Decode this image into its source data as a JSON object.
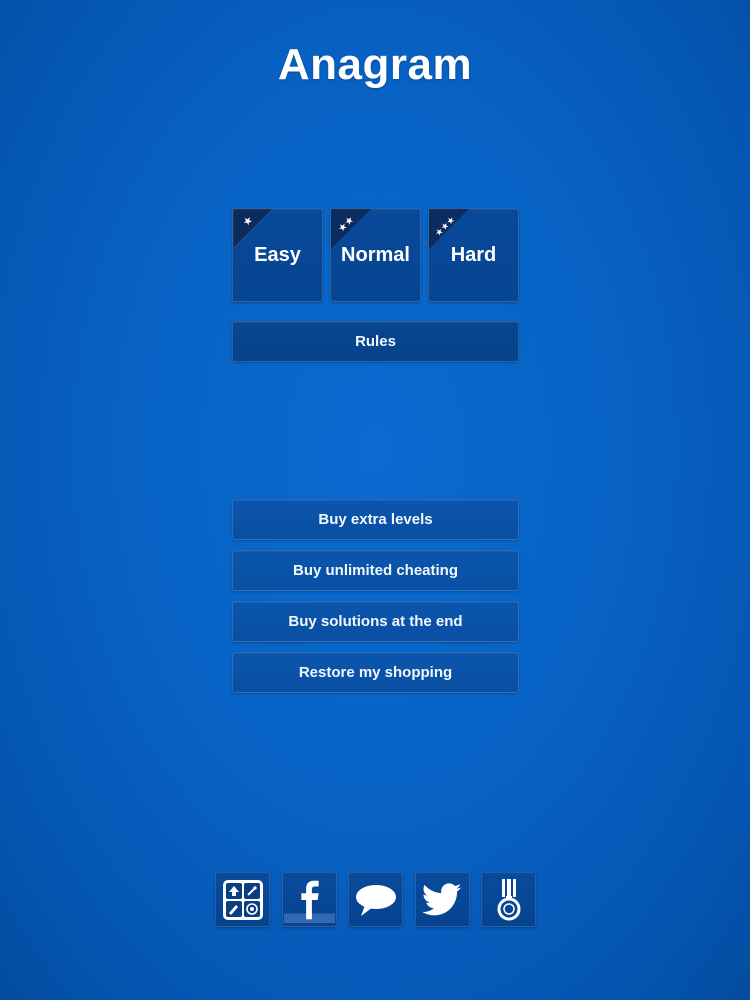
{
  "header": {
    "title": "Anagram"
  },
  "difficulty": [
    {
      "label": "Easy",
      "stars": 1
    },
    {
      "label": "Normal",
      "stars": 2
    },
    {
      "label": "Hard",
      "stars": 3
    }
  ],
  "rules_label": "Rules",
  "shop": {
    "items": [
      {
        "label": "Buy extra levels"
      },
      {
        "label": "Buy unlimited cheating"
      },
      {
        "label": "Buy solutions at the end"
      },
      {
        "label": "Restore my shopping"
      }
    ]
  },
  "footer": {
    "icons": [
      "more-apps-icon",
      "facebook-icon",
      "speech-bubble-icon",
      "twitter-icon",
      "medal-icon"
    ]
  },
  "colors": {
    "background": "#0863c5",
    "tile": "#07479a",
    "ribbon": "#0b2c5c",
    "text": "#ffffff"
  }
}
